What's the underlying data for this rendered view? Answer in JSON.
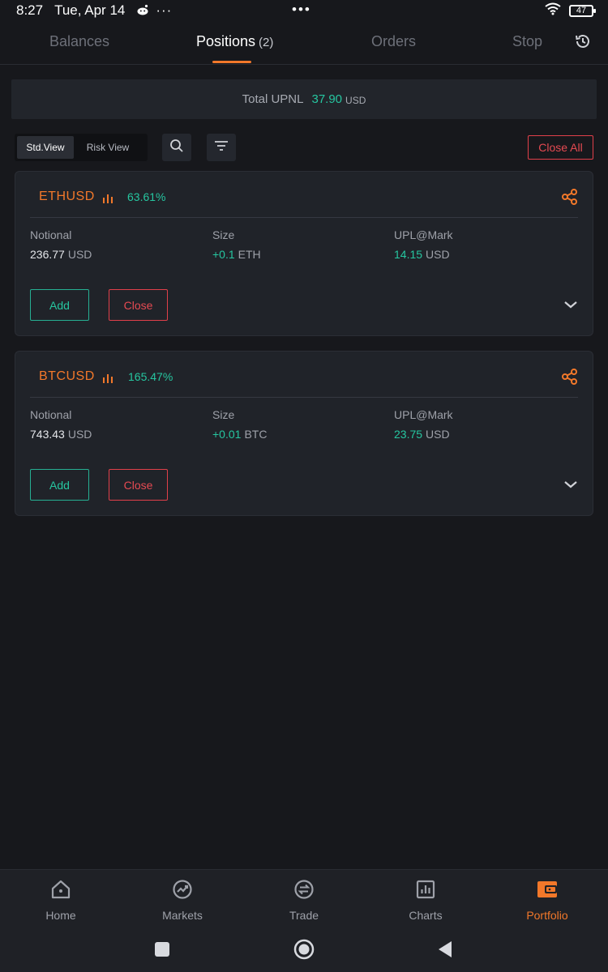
{
  "status_bar": {
    "time": "8:27",
    "date": "Tue, Apr 14",
    "more": "···",
    "center": "•••",
    "battery": "47"
  },
  "tabs": [
    {
      "label": "Balances",
      "active": false
    },
    {
      "label": "Positions",
      "count": "(2)",
      "active": true
    },
    {
      "label": "Orders",
      "active": false
    },
    {
      "label": "Stop",
      "active": false
    }
  ],
  "upnl": {
    "label": "Total UPNL",
    "value": "37.90",
    "unit": "USD"
  },
  "toolbar": {
    "std_view": "Std.View",
    "risk_view": "Risk View",
    "close_all": "Close All"
  },
  "positions": [
    {
      "symbol": "ETHUSD",
      "pct": "63.61%",
      "notional_label": "Notional",
      "notional_value": "236.77",
      "notional_unit": "USD",
      "size_label": "Size",
      "size_value": "+0.1",
      "size_unit": "ETH",
      "upl_label": "UPL@Mark",
      "upl_value": "14.15",
      "upl_unit": "USD",
      "add_label": "Add",
      "close_label": "Close"
    },
    {
      "symbol": "BTCUSD",
      "pct": "165.47%",
      "notional_label": "Notional",
      "notional_value": "743.43",
      "notional_unit": "USD",
      "size_label": "Size",
      "size_value": "+0.01",
      "size_unit": "BTC",
      "upl_label": "UPL@Mark",
      "upl_value": "23.75",
      "upl_unit": "USD",
      "add_label": "Add",
      "close_label": "Close"
    }
  ],
  "bottom_nav": [
    {
      "label": "Home",
      "icon": "home-icon",
      "active": false
    },
    {
      "label": "Markets",
      "icon": "markets-icon",
      "active": false
    },
    {
      "label": "Trade",
      "icon": "trade-icon",
      "active": false
    },
    {
      "label": "Charts",
      "icon": "charts-icon",
      "active": false
    },
    {
      "label": "Portfolio",
      "icon": "wallet-icon",
      "active": true
    }
  ],
  "colors": {
    "accent": "#f2782a",
    "positive": "#26c6a0",
    "negative": "#e64a52",
    "background": "#17181c",
    "card": "#202329"
  }
}
